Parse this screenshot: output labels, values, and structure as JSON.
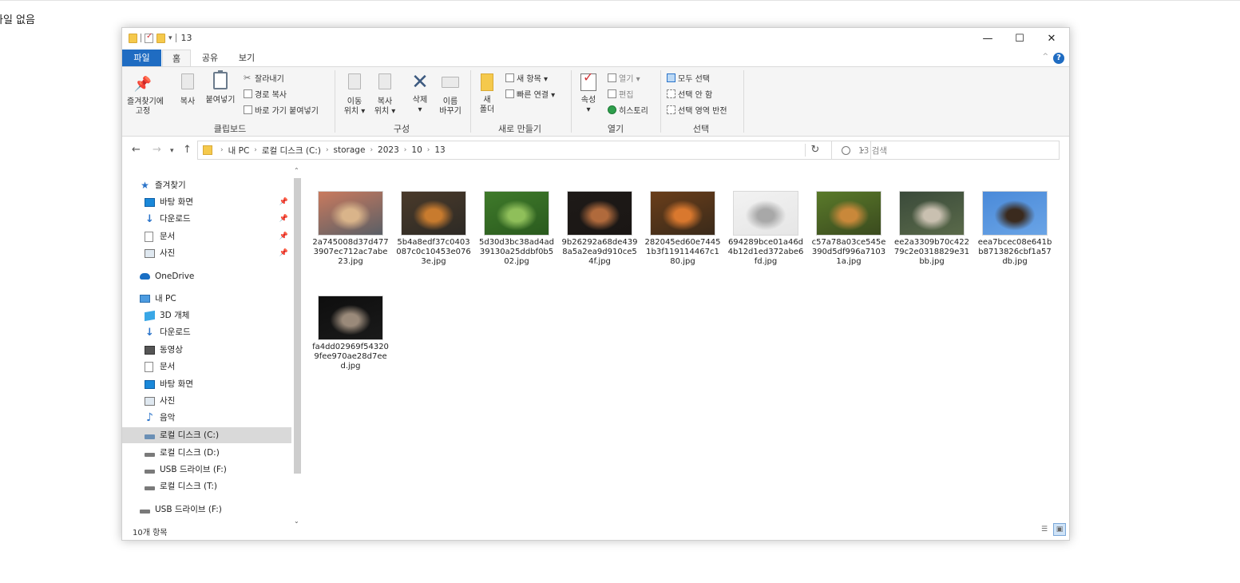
{
  "page": {
    "status_text": "파일 없음"
  },
  "window": {
    "title": "13",
    "controls": {
      "minimize": "—",
      "maximize": "☐",
      "close": "✕"
    }
  },
  "ribbon": {
    "tabs": [
      "파일",
      "홈",
      "공유",
      "보기"
    ],
    "help": "?",
    "clipboard": {
      "label": "클립보드",
      "pin": "즐겨찾기에\n고정",
      "copy": "복사",
      "paste": "붙여넣기",
      "cut": "잘라내기",
      "copy_path": "경로 복사",
      "paste_shortcut": "바로 가기 붙여넣기"
    },
    "organize": {
      "label": "구성",
      "move_to": "이동\n위치 ▾",
      "copy_to": "복사\n위치 ▾",
      "delete": "삭제\n▾",
      "rename": "이름\n바꾸기"
    },
    "new": {
      "label": "새로 만들기",
      "new_folder": "새\n폴더",
      "new_item": "새 항목 ▾",
      "easy_access": "빠른 연결 ▾"
    },
    "open": {
      "label": "열기",
      "properties": "속성\n▾",
      "open": "열기 ▾",
      "edit": "편집",
      "history": "히스토리"
    },
    "select": {
      "label": "선택",
      "select_all": "모두 선택",
      "select_none": "선택 안 함",
      "invert": "선택 영역 반전"
    }
  },
  "address": {
    "crumbs": [
      "내 PC",
      "로컬 디스크 (C:)",
      "storage",
      "2023",
      "10",
      "13"
    ],
    "search_placeholder": "13 검색"
  },
  "nav": {
    "items": [
      {
        "label": "즐겨찾기",
        "icon": "star-icon"
      },
      {
        "label": "바탕 화면",
        "icon": "desktop-icon"
      },
      {
        "label": "다운로드",
        "icon": "download-icon"
      },
      {
        "label": "문서",
        "icon": "document-icon"
      },
      {
        "label": "사진",
        "icon": "pictures-icon"
      },
      {
        "label": "OneDrive",
        "icon": "cloud-icon"
      },
      {
        "label": "내 PC",
        "icon": "pc-icon"
      },
      {
        "label": "3D 개체",
        "icon": "cube-icon"
      },
      {
        "label": "다운로드",
        "icon": "download-icon"
      },
      {
        "label": "동영상",
        "icon": "video-icon"
      },
      {
        "label": "문서",
        "icon": "document-icon"
      },
      {
        "label": "바탕 화면",
        "icon": "desktop-icon"
      },
      {
        "label": "사진",
        "icon": "pictures-icon"
      },
      {
        "label": "음악",
        "icon": "music-icon"
      },
      {
        "label": "로컬 디스크 (C:)",
        "icon": "drive-icon"
      },
      {
        "label": "로컬 디스크 (D:)",
        "icon": "drive-icon"
      },
      {
        "label": "USB 드라이브 (F:)",
        "icon": "drive-icon"
      },
      {
        "label": "로컬 디스크 (T:)",
        "icon": "drive-icon"
      },
      {
        "label": "USB 드라이브 (F:)",
        "icon": "drive-icon"
      }
    ]
  },
  "files": [
    {
      "name": "2a745008d37d4773907ec712ac7abe23.jpg",
      "colors": [
        "#c97a5e",
        "#d9b48a",
        "#5a5f66"
      ]
    },
    {
      "name": "5b4a8edf37c0403087c0c10453e0763e.jpg",
      "colors": [
        "#4a3a2a",
        "#c87b2e",
        "#2d2a25"
      ]
    },
    {
      "name": "5d30d3bc38ad4ad39130a25ddbf0b502.jpg",
      "colors": [
        "#3f7a2a",
        "#8fbf5a",
        "#2a5a1e"
      ]
    },
    {
      "name": "9b26292a68de4398a5a2ea9d910ce54f.jpg",
      "colors": [
        "#1e1a18",
        "#b06a3c",
        "#1a1614"
      ]
    },
    {
      "name": "282045ed60e74451b3f119114467c180.jpg",
      "colors": [
        "#6a3e1a",
        "#d9782e",
        "#3a2a1a"
      ]
    },
    {
      "name": "694289bce01a46d4b12d1ed372abe6fd.jpg",
      "colors": [
        "#f2f2f2",
        "#a8a8a8",
        "#e6e6e6"
      ]
    },
    {
      "name": "c57a78a03ce545e390d5df996a71031a.jpg",
      "colors": [
        "#5a7a2a",
        "#c9883a",
        "#3a4a1e"
      ]
    },
    {
      "name": "ee2a3309b70c42279c2e0318829e31bb.jpg",
      "colors": [
        "#3a4a3a",
        "#c9c0b0",
        "#5a6a4a"
      ]
    },
    {
      "name": "eea7bcec08e641bb8713826cbf1a57db.jpg",
      "colors": [
        "#4a8ad9",
        "#3a2a1e",
        "#6aa4e6"
      ]
    },
    {
      "name": "fa4dd02969f543209fee970ae28d7eed.jpg",
      "colors": [
        "#0e0e0e",
        "#9a8a7a",
        "#1a1a1a"
      ]
    }
  ],
  "statusbar": {
    "count": "10개 항목"
  }
}
